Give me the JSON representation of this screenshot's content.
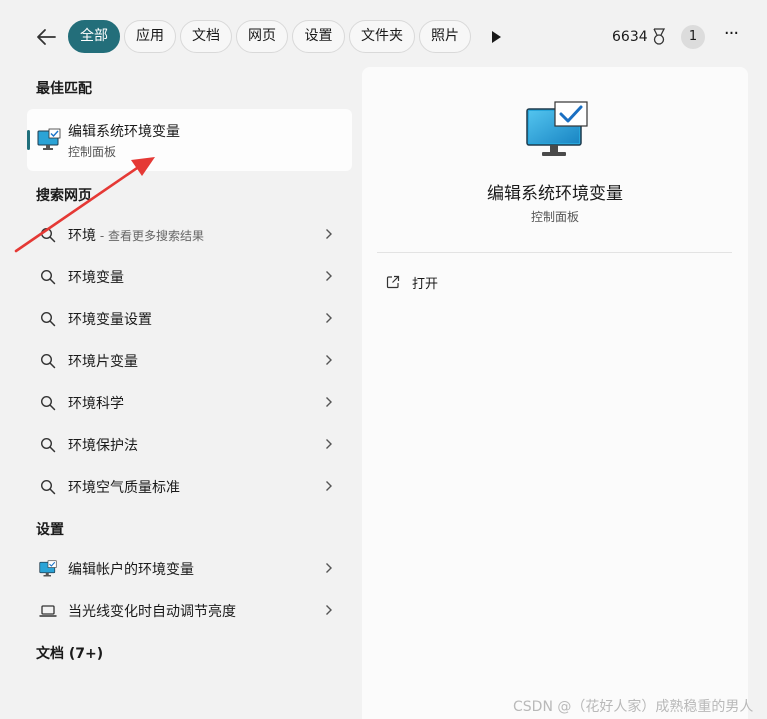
{
  "topbar": {
    "filters": [
      "全部",
      "应用",
      "文档",
      "网页",
      "设置",
      "文件夹",
      "照片"
    ],
    "points": "6634",
    "avatar_label": "1",
    "more_label": "···"
  },
  "best_match": {
    "section": "最佳匹配",
    "title": "编辑系统环境变量",
    "subtitle": "控制面板"
  },
  "web_search": {
    "section": "搜索网页",
    "first": {
      "label": "环境",
      "hint": " - 查看更多搜索结果"
    },
    "items": [
      "环境变量",
      "环境变量设置",
      "环境片变量",
      "环境科学",
      "环境保护法",
      "环境空气质量标准"
    ]
  },
  "settings": {
    "section": "设置",
    "items": [
      "编辑帐户的环境变量",
      "当光线变化时自动调节亮度"
    ]
  },
  "documents": {
    "section": "文档 (7+)"
  },
  "detail": {
    "title": "编辑系统环境变量",
    "subtitle": "控制面板",
    "open_label": "打开"
  },
  "annotation": {
    "color": "#e53935"
  },
  "watermark": "CSDN @（花好人家）成熟稳重的男人",
  "colors": {
    "accent": "#236e7a",
    "background": "#f2f2f2"
  }
}
